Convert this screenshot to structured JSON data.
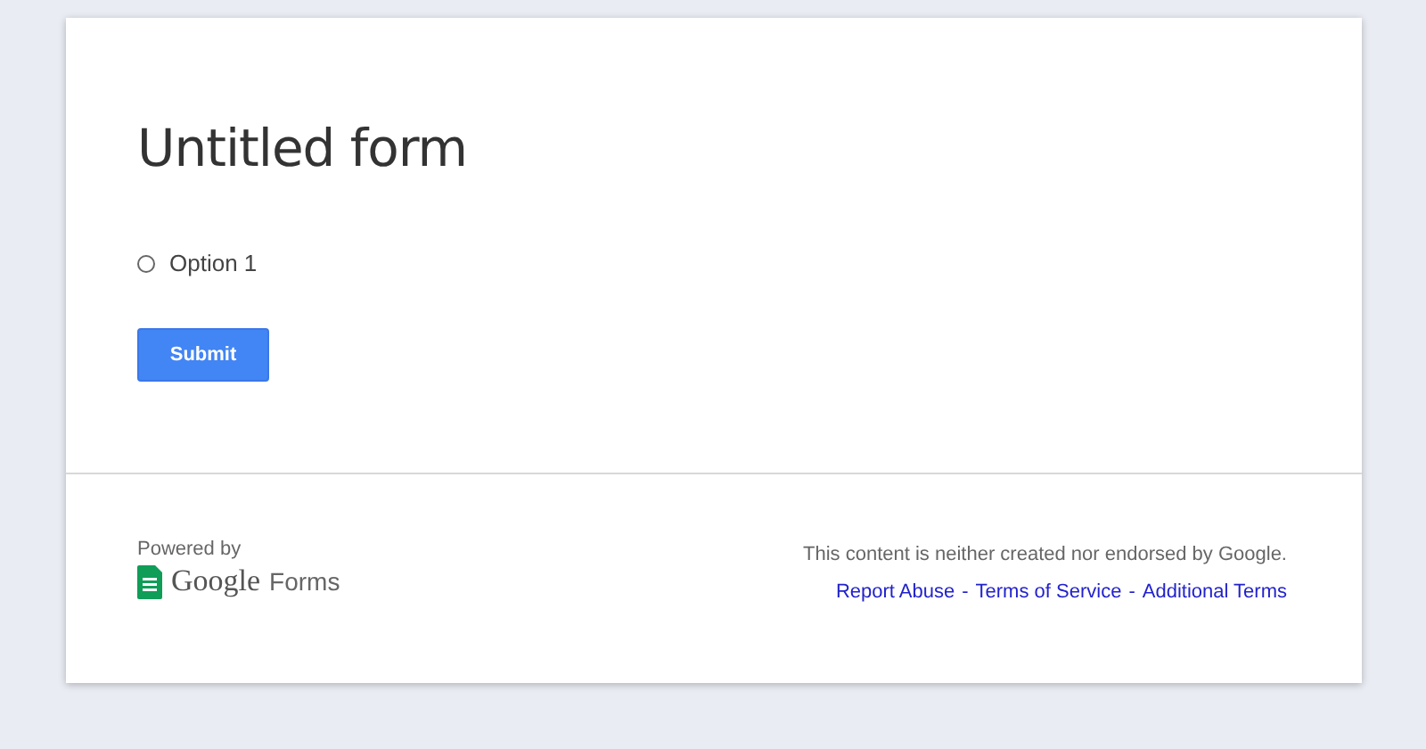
{
  "form": {
    "title": "Untitled form",
    "options": [
      {
        "label": "Option 1",
        "selected": false
      }
    ],
    "submit": "Submit"
  },
  "footer": {
    "powered_by": "Powered by",
    "logo": {
      "brand": "Google",
      "product": "Forms"
    },
    "disclaimer": "This content is neither created nor endorsed by Google.",
    "links": [
      "Report Abuse",
      "Terms of Service",
      "Additional Terms"
    ],
    "separator": "-"
  }
}
